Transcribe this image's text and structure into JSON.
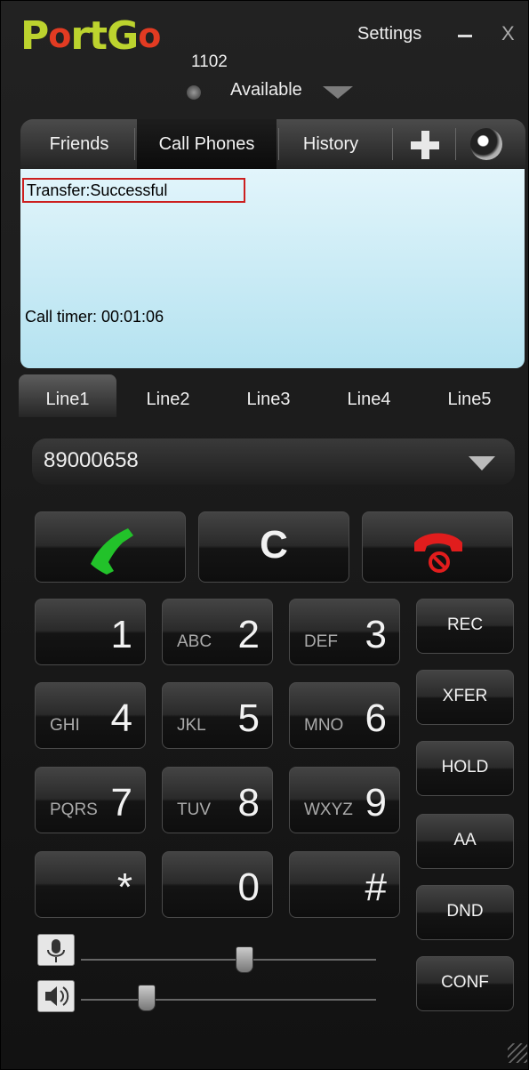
{
  "header": {
    "logo": {
      "p": "P",
      "o1": "o",
      "rtg": "rtG",
      "o2": "o"
    },
    "extension": "1102",
    "status": "Available",
    "settings_label": "Settings",
    "close_label": "X"
  },
  "tabs": [
    {
      "label": "Friends"
    },
    {
      "label": "Call Phones",
      "active": true
    },
    {
      "label": "History"
    }
  ],
  "display": {
    "transfer_status": "Transfer:Successful",
    "call_timer": "Call timer: 00:01:06"
  },
  "lines": [
    {
      "label": "Line1",
      "active": true
    },
    {
      "label": "Line2"
    },
    {
      "label": "Line3"
    },
    {
      "label": "Line4"
    },
    {
      "label": "Line5"
    }
  ],
  "dial_input": {
    "value": "89000658"
  },
  "actions": {
    "clear_label": "C"
  },
  "keypad": [
    {
      "digit": "1",
      "letters": ""
    },
    {
      "digit": "2",
      "letters": "ABC"
    },
    {
      "digit": "3",
      "letters": "DEF"
    },
    {
      "digit": "4",
      "letters": "GHI"
    },
    {
      "digit": "5",
      "letters": "JKL"
    },
    {
      "digit": "6",
      "letters": "MNO"
    },
    {
      "digit": "7",
      "letters": "PQRS"
    },
    {
      "digit": "8",
      "letters": "TUV"
    },
    {
      "digit": "9",
      "letters": "WXYZ"
    },
    {
      "digit": "*",
      "letters": ""
    },
    {
      "digit": "0",
      "letters": ""
    },
    {
      "digit": "#",
      "letters": ""
    }
  ],
  "side_buttons": [
    {
      "label": "REC"
    },
    {
      "label": "XFER"
    },
    {
      "label": "HOLD"
    },
    {
      "label": "AA"
    },
    {
      "label": "DND"
    },
    {
      "label": "CONF"
    }
  ],
  "volume": {
    "mic_level": 0.55,
    "speaker_level": 0.22
  },
  "colors": {
    "logo_green": "#bcd32e",
    "logo_red": "#e23b22",
    "call_green": "#22c22a",
    "hangup_red": "#e11d1d",
    "display_blue": "#c9ebf5"
  }
}
